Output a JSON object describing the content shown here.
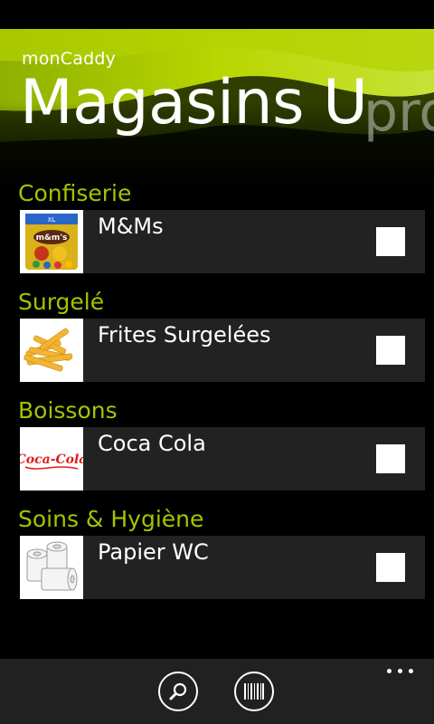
{
  "app": {
    "name": "monCaddy",
    "panorama_title": "Magasins U",
    "panorama_next_peek": "pro"
  },
  "colors": {
    "accent": "#a4c400",
    "item_background": "#222222",
    "appbar_background": "#212121"
  },
  "groups": [
    {
      "label": "Confiserie",
      "items": [
        {
          "label": "M&Ms",
          "icon": "mms-pack-icon",
          "checked": false
        }
      ]
    },
    {
      "label": "Surgelé",
      "items": [
        {
          "label": "Frites Surgelées",
          "icon": "french-fries-icon",
          "checked": false
        }
      ]
    },
    {
      "label": "Boissons",
      "items": [
        {
          "label": "Coca Cola",
          "icon": "coca-cola-logo-icon",
          "checked": false
        }
      ]
    },
    {
      "label": "Soins & Hygiène",
      "items": [
        {
          "label": "Papier WC",
          "icon": "toilet-paper-icon",
          "checked": false
        }
      ]
    }
  ],
  "thumbnails": {
    "coca_cola_logo_text": "Coca-Cola",
    "mms_pack_text": "m&m's"
  },
  "app_bar": {
    "buttons": [
      {
        "icon": "search-icon"
      },
      {
        "icon": "barcode-icon"
      }
    ],
    "more_icon": "more-dots-icon"
  }
}
